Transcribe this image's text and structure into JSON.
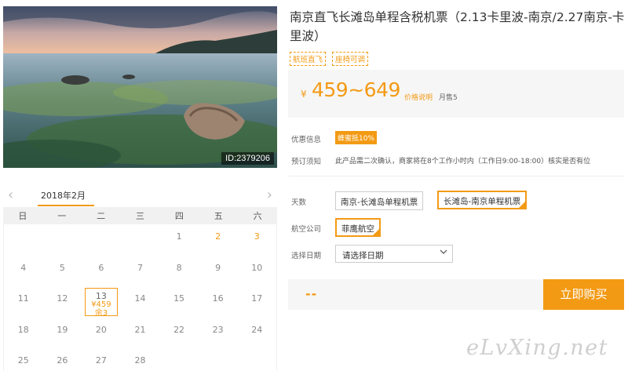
{
  "product": {
    "title": "南京直飞长滩岛单程含税机票（2.13卡里波-南京/2.27南京-卡里波）",
    "tags": [
      "航班直飞",
      "座椅可调"
    ],
    "photo_id": "ID:2379206"
  },
  "price": {
    "currency": "¥",
    "range": "459~649",
    "note": "价格说明",
    "sold": "月售5"
  },
  "info": {
    "promo_label": "优惠信息",
    "promo_badge": "蜂蜜抵10%",
    "notice_label": "预订须知",
    "notice_text": "此产品需二次确认，商家将在8个工作小时内（工作日9:00-18:00）核实是否有位"
  },
  "options": {
    "days_label": "天数",
    "days": [
      "南京-长滩岛单程机票",
      "长滩岛-南京单程机票"
    ],
    "days_selected": 1,
    "airline_label": "航空公司",
    "airline": "菲鹰航空",
    "date_label": "选择日期",
    "date_placeholder": "请选择日期"
  },
  "purchase": {
    "total": "--",
    "buy_label": "立即购买"
  },
  "calendar": {
    "month": "2018年2月",
    "prev": "‹",
    "next": "›",
    "weekdays": [
      "日",
      "一",
      "二",
      "三",
      "四",
      "五",
      "六"
    ],
    "selected_price": "¥459",
    "selected_stock": "余3"
  },
  "watermark": "eLvXing.net",
  "colors": {
    "accent": "#f39a14",
    "panel": "#f6f6f6"
  }
}
